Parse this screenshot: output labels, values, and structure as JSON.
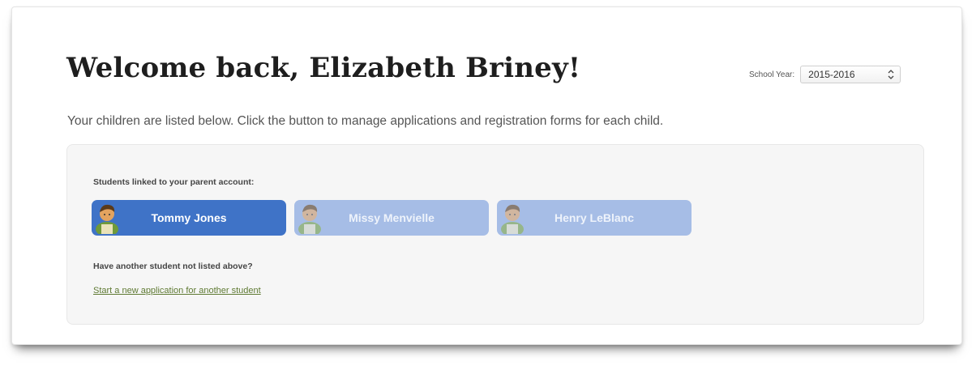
{
  "header": {
    "title": "Welcome back, Elizabeth Briney!",
    "school_year_label": "School Year:",
    "school_year_selected": "2015-2016"
  },
  "intro": "Your children are listed below. Click the button to manage applications and registration forms for each child.",
  "students_panel": {
    "heading": "Students linked to your parent account:",
    "students": [
      {
        "name": "Tommy Jones",
        "selected": true
      },
      {
        "name": "Missy Menvielle",
        "selected": false
      },
      {
        "name": "Henry LeBlanc",
        "selected": false
      }
    ],
    "other_heading": "Have another student not listed above?",
    "new_application_link": "Start a new application for another student"
  },
  "colors": {
    "active_button": "#3f73c7",
    "inactive_button": "#a6bde6",
    "link": "#5f7a33"
  },
  "icons": {
    "student_avatar": "student-avatar-icon",
    "select_arrow": "chevron-updown-icon"
  }
}
